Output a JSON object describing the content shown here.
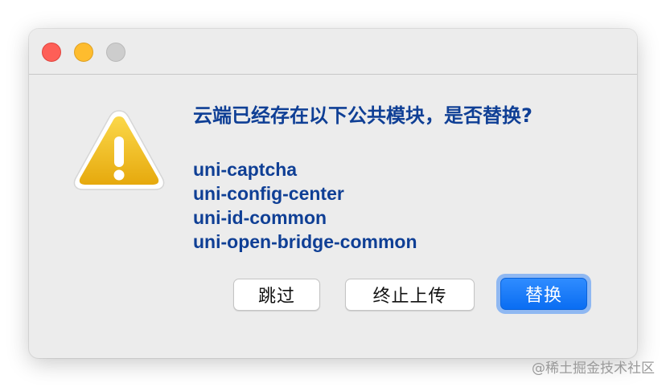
{
  "dialog": {
    "title": "云端已经存在以下公共模块，是否替换?",
    "icon": "warning-icon",
    "modules": [
      "uni-captcha",
      "uni-config-center",
      "uni-id-common",
      "uni-open-bridge-common"
    ],
    "buttons": {
      "skip_label": "跳过",
      "stop_upload_label": "终止上传",
      "replace_label": "替换"
    }
  },
  "window_controls": {
    "close": "close-button",
    "minimize": "minimize-button",
    "zoom": "zoom-button"
  },
  "colors": {
    "text_accent": "#0f3f95",
    "primary_button": "#0a6df2",
    "window_background": "#ececec"
  },
  "watermark": "@稀土掘金技术社区"
}
